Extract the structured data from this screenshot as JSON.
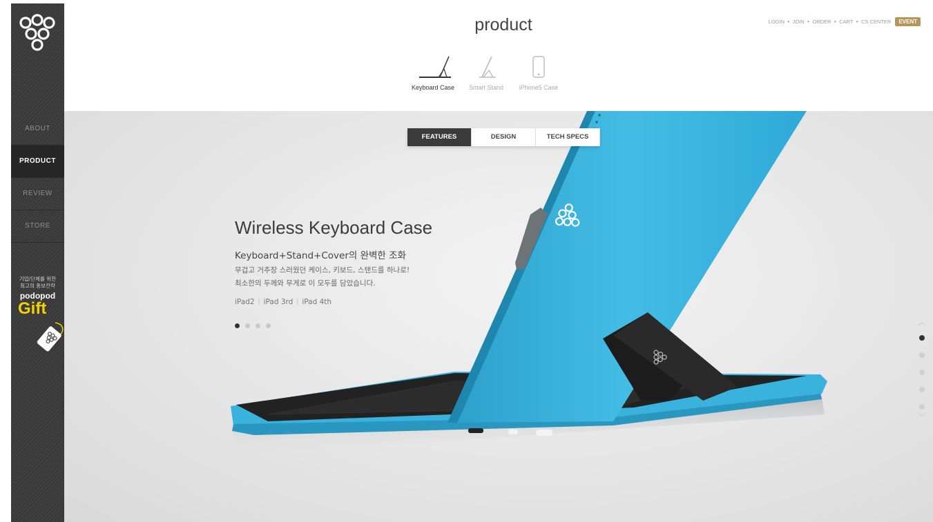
{
  "header": {
    "page_title": "product"
  },
  "util_links": [
    "LOGIN",
    "JOIN",
    "ORDER",
    "CART",
    "CS CENTER"
  ],
  "event_label": "EVENT",
  "categories": [
    {
      "label": "Keyboard Case",
      "active": true
    },
    {
      "label": "Smart Stand",
      "active": false
    },
    {
      "label": "iPhone5 Case",
      "active": false
    }
  ],
  "sidebar": {
    "nav": [
      "ABOUT",
      "PRODUCT",
      "REVIEW",
      "STORE"
    ],
    "active_index": 1,
    "gift": {
      "line1": "기업/단체를 위한",
      "line2": "최고의 홍보전략",
      "brand": "podopod",
      "word": "Gift"
    }
  },
  "tabs": [
    "FEATURES",
    "DESIGN",
    "TECH SPECS"
  ],
  "hero": {
    "title": "Wireless Keyboard Case",
    "subtitle": "Keyboard+Stand+Cover의 완벽한 조화",
    "desc1": "무겁고 거추장 스러웠던 케이스, 키보드, 스탠드를 하나로!",
    "desc2": "최소한의 두께와 무게로 이 모두를 담았습니다.",
    "models": [
      "iPad2",
      "iPad 3rd",
      "iPad 4th"
    ]
  },
  "slider": {
    "count": 4,
    "active": 0
  },
  "vertical_nav": {
    "count": 5,
    "active": 0
  },
  "colors": {
    "accent_blue": "#3fb5dd",
    "event_gold": "#b8935a",
    "gift_yellow": "#f5d100",
    "sidebar": "#3a3a3a"
  }
}
